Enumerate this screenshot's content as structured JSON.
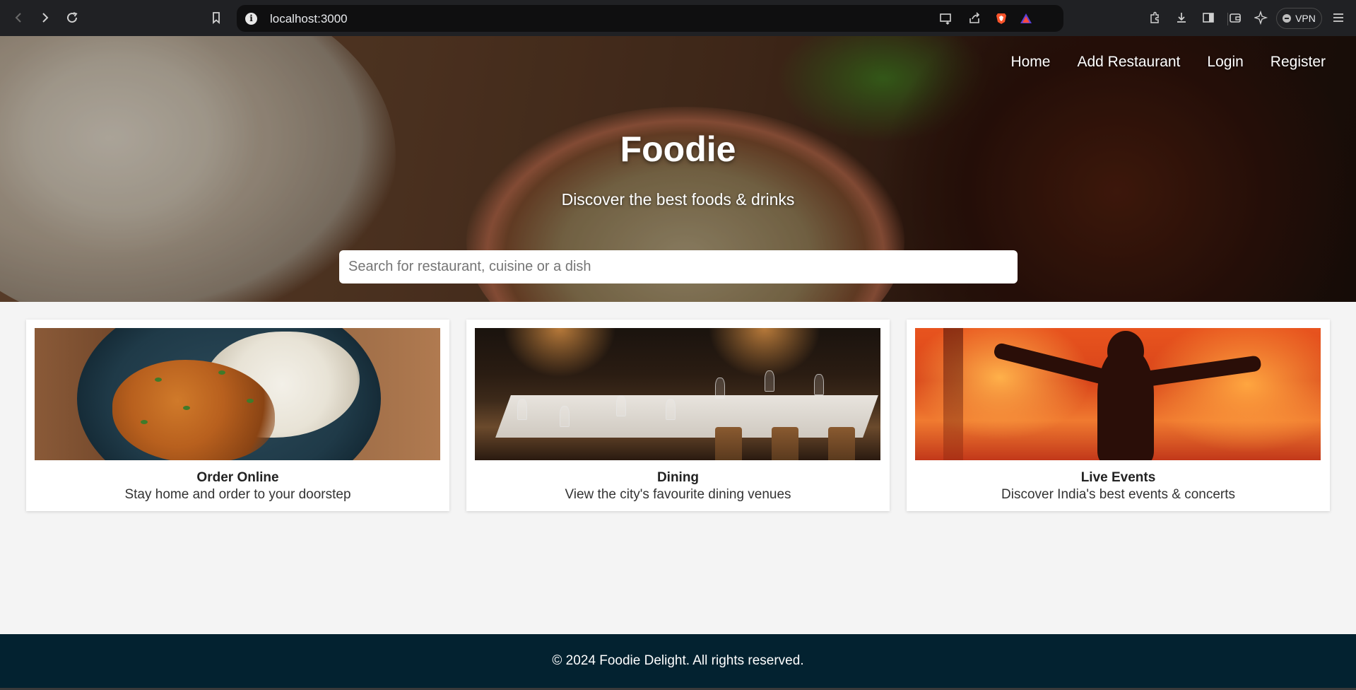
{
  "browser": {
    "url": "localhost:3000",
    "vpn_label": "VPN",
    "icons": [
      "back-icon",
      "forward-icon",
      "reload-icon",
      "bookmark-icon",
      "info-icon",
      "cast-icon",
      "share-icon",
      "brave-shield-icon",
      "brave-rewards-icon",
      "extensions-icon",
      "download-icon",
      "sidebar-icon",
      "wallet-icon",
      "leo-ai-icon",
      "menu-icon"
    ]
  },
  "nav": {
    "items": [
      {
        "label": "Home"
      },
      {
        "label": "Add Restaurant"
      },
      {
        "label": "Login"
      },
      {
        "label": "Register"
      }
    ]
  },
  "hero": {
    "title": "Foodie",
    "subtitle": "Discover the best foods & drinks",
    "search_placeholder": "Search for restaurant, cuisine or a dish"
  },
  "cards": [
    {
      "title": "Order Online",
      "description": "Stay home and order to your doorstep"
    },
    {
      "title": "Dining",
      "description": "View the city's favourite dining venues"
    },
    {
      "title": "Live Events",
      "description": "Discover India's best events & concerts"
    }
  ],
  "footer": {
    "text": "© 2024 Foodie Delight. All rights reserved."
  },
  "colors": {
    "footer_bg": "#032230",
    "page_bg": "#f4f4f4",
    "chrome_bg": "#202124"
  }
}
